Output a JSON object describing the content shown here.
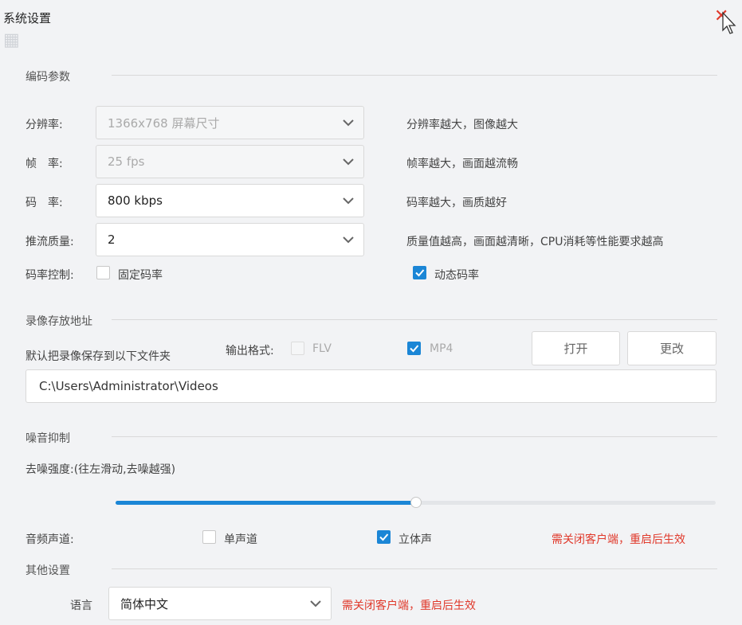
{
  "window": {
    "title": "系统设置"
  },
  "encoding": {
    "section_title": "编码参数",
    "resolution": {
      "label": "分辨率:",
      "value": "1366x768 屏幕尺寸",
      "hint": "分辨率越大，图像越大"
    },
    "framerate": {
      "label": "帧　率:",
      "value": "25 fps",
      "hint": "帧率越大，画面越流畅"
    },
    "bitrate": {
      "label": "码　率:",
      "value": "800 kbps",
      "hint": "码率越大，画质越好"
    },
    "quality": {
      "label": "推流质量:",
      "value": "2",
      "hint": "质量值越高，画面越清晰，CPU消耗等性能要求越高"
    },
    "rate_control": {
      "label": "码率控制:",
      "fixed_label": "固定码率",
      "fixed_checked": false,
      "dynamic_label": "动态码率",
      "dynamic_checked": true
    }
  },
  "recording": {
    "section_title": "录像存放地址",
    "desc": "默认把录像保存到以下文件夹",
    "format_label": "输出格式:",
    "flv_label": "FLV",
    "flv_checked": false,
    "mp4_label": "MP4",
    "mp4_checked": true,
    "open_button": "打开",
    "change_button": "更改",
    "path": "C:\\Users\\Administrator\\Videos"
  },
  "noise": {
    "section_title": "噪音抑制",
    "strength_label": "去噪强度:(往左滑动,去噪越强)",
    "slider_fraction": 0.5
  },
  "audio": {
    "label": "音频声道:",
    "mono_label": "单声道",
    "mono_checked": false,
    "stereo_label": "立体声",
    "stereo_checked": true,
    "restart_notice": "需关闭客户端，重启后生效"
  },
  "other": {
    "section_title": "其他设置",
    "language_label": "语言",
    "language_value": "简体中文",
    "restart_notice": "需关闭客户端，重启后生效"
  },
  "colors": {
    "accent": "#1b86d6",
    "warning": "#e0392b"
  },
  "icons": {
    "close": "close-icon",
    "dropdown": "chevron-down-icon",
    "check": "check-icon",
    "cursor": "mouse-cursor-icon"
  }
}
